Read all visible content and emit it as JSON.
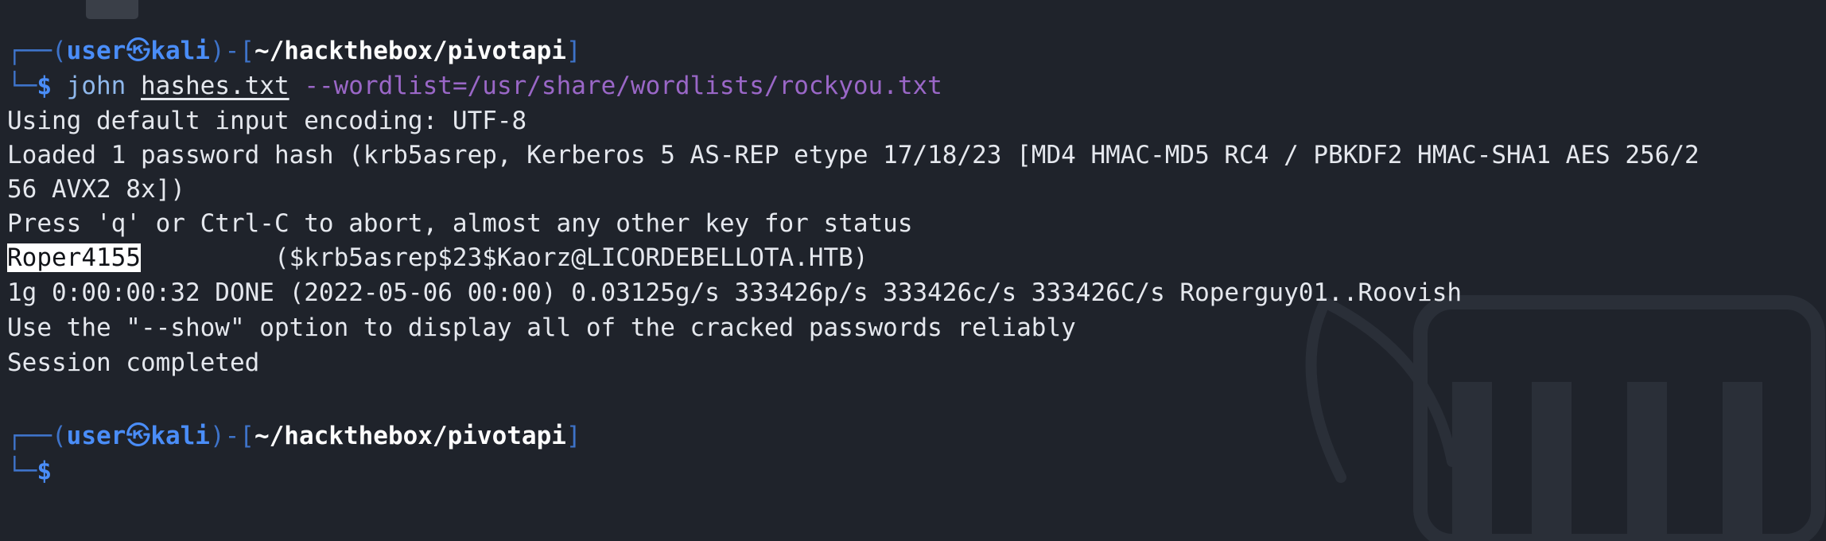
{
  "prompt1": {
    "box_top": "┌──(",
    "user": "user",
    "at_symbol": "㉿",
    "host": "kali",
    "mid": ")-[",
    "cwd": "~/hackthebox/pivotapi",
    "close": "]",
    "box_bottom": "└─",
    "dollar": "$",
    "command": "john",
    "arg_file": "hashes.txt",
    "arg_opt": "--wordlist=/usr/share/wordlists/rockyou.txt"
  },
  "output": {
    "line1": "Using default input encoding: UTF-8",
    "line2": "Loaded 1 password hash (krb5asrep, Kerberos 5 AS-REP etype 17/18/23 [MD4 HMAC-MD5 RC4 / PBKDF2 HMAC-SHA1 AES 256/2",
    "line3": "56 AVX2 8x])",
    "line4": "Press 'q' or Ctrl-C to abort, almost any other key for status",
    "cracked_password": "Roper4155",
    "cracked_gap": "         ",
    "cracked_hash": "($krb5asrep$23$Kaorz@LICORDEBELLOTA.HTB)",
    "line6": "1g 0:00:00:32 DONE (2022-05-06 00:00) 0.03125g/s 333426p/s 333426c/s 333426C/s Roperguy01..Roovish",
    "line7": "Use the \"--show\" option to display all of the cracked passwords reliably",
    "line8": "Session completed"
  },
  "prompt2": {
    "box_top": "┌──(",
    "user": "user",
    "at_symbol": "㉿",
    "host": "kali",
    "mid": ")-[",
    "cwd": "~/hackthebox/pivotapi",
    "close": "]",
    "box_bottom": "└─",
    "dollar": "$"
  },
  "colors": {
    "background": "#1f232b",
    "prompt_blue": "#4a8df8",
    "option_purple": "#9a67c7",
    "highlight": "#ffffff"
  }
}
